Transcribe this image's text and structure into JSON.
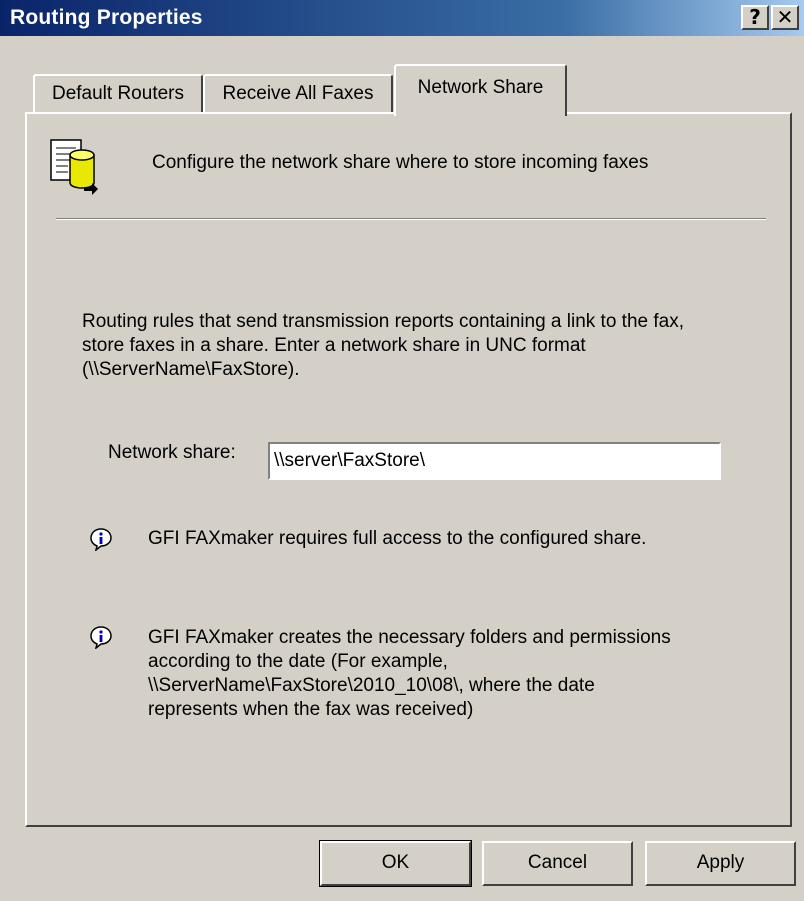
{
  "window": {
    "title": "Routing Properties",
    "help_glyph": "?",
    "close_glyph": "✕"
  },
  "tabs": [
    {
      "label": "Default Routers"
    },
    {
      "label": "Receive All Faxes"
    },
    {
      "label": "Network Share",
      "selected": true
    }
  ],
  "panel": {
    "header_icon": "database-document-icon",
    "header_text": "Configure the network share where to store incoming faxes",
    "description_lines": [
      "Routing rules that send transmission reports containing a link to the fax,",
      "store faxes in a share. Enter a network share in UNC format",
      "(\\\\ServerName\\FaxStore)."
    ],
    "share_label": "Network share:",
    "share_value": "\\\\server\\FaxStore\\",
    "info1": "GFI FAXmaker requires full access to the configured share.",
    "info2_lines": [
      "GFI FAXmaker creates the necessary folders and permissions",
      "according to the date (For example,",
      "\\\\ServerName\\FaxStore\\2010_10\\08\\, where the date",
      "represents when the fax was received)"
    ]
  },
  "buttons": {
    "ok": "OK",
    "cancel": "Cancel",
    "apply": "Apply"
  },
  "colors": {
    "titlebar_start": "#0a246a",
    "titlebar_end": "#a6caf0",
    "face": "#d4d0c8"
  }
}
